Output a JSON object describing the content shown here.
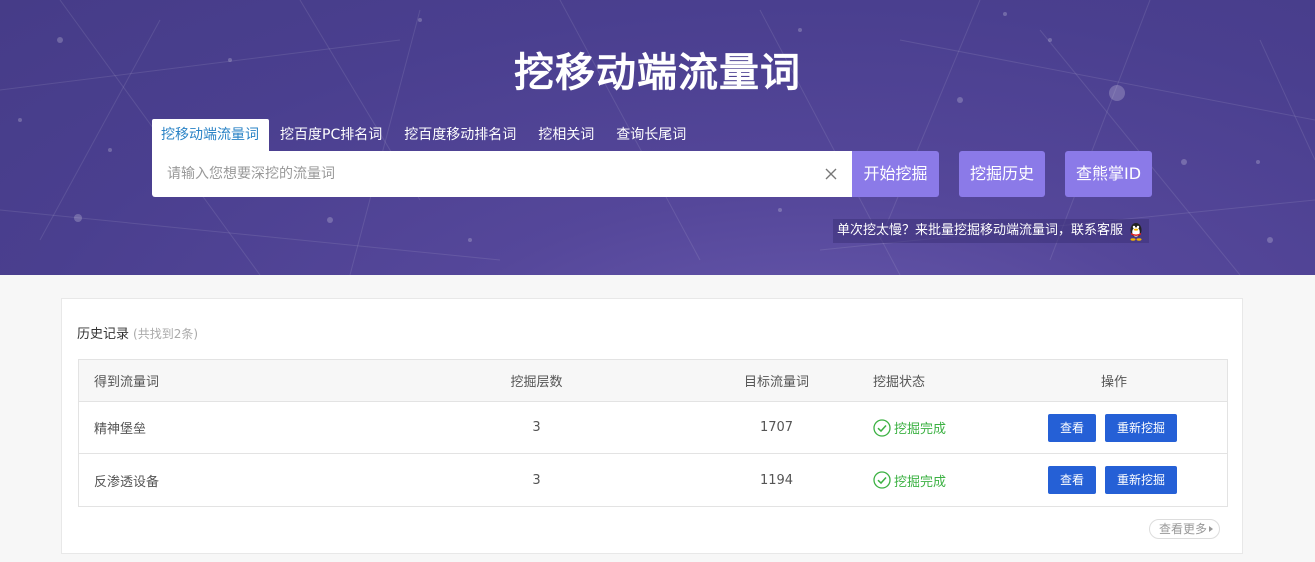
{
  "hero": {
    "title": "挖移动端流量词",
    "tabs": [
      {
        "label": "挖移动端流量词",
        "active": true
      },
      {
        "label": "挖百度PC排名词",
        "active": false
      },
      {
        "label": "挖百度移动排名词",
        "active": false
      },
      {
        "label": "挖相关词",
        "active": false
      },
      {
        "label": "查询长尾词",
        "active": false
      }
    ],
    "search": {
      "placeholder": "请输入您想要深挖的流量词",
      "value": ""
    },
    "buttons": {
      "start": "开始挖掘",
      "history": "挖掘历史",
      "check_id": "查熊掌ID"
    },
    "promo_text": "单次挖太慢？来批量挖掘移动端流量词，联系客服"
  },
  "history": {
    "title": "历史记录",
    "count_text": "(共找到2条)",
    "columns": [
      "得到流量词",
      "挖掘层数",
      "目标流量词",
      "挖掘状态",
      "操作"
    ],
    "rows": [
      {
        "keyword": "精神堡垒",
        "layers": "3",
        "target": "1707",
        "status": "挖掘完成",
        "view": "查看",
        "redig": "重新挖掘"
      },
      {
        "keyword": "反渗透设备",
        "layers": "3",
        "target": "1194",
        "status": "挖掘完成",
        "view": "查看",
        "redig": "重新挖掘"
      }
    ],
    "more": "查看更多"
  },
  "colors": {
    "hero_bg": "#4a3f8f",
    "accent_purple": "#8b7ae8",
    "tab_active_text": "#2a83c6",
    "status_green": "#3bb142",
    "button_blue": "#2560d6"
  }
}
